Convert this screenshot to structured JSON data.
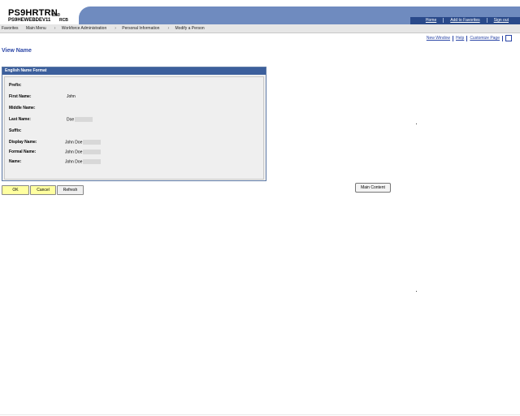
{
  "header": {
    "system_title": "PS9HRTRN",
    "version": "8.50",
    "database": "PS9HEWEBDEV11",
    "code": "RCB",
    "links": [
      "Home",
      "Add to Favorites",
      "Sign out"
    ]
  },
  "nav": {
    "items": [
      "Favorites",
      "Main Menu",
      "Workforce Administration",
      "Personal Information",
      "Modify a Person"
    ]
  },
  "page_links": [
    "New Window",
    "Help",
    "Customize Page"
  ],
  "page_title": "View Name",
  "panel": {
    "title": "English Name Format",
    "fields": [
      {
        "label": "Prefix:",
        "value": ""
      },
      {
        "label": "First Name:",
        "value": "John"
      },
      {
        "label": "Middle Name:",
        "value": ""
      },
      {
        "label": "Last Name:",
        "value": "Doe"
      },
      {
        "label": "Suffix:",
        "value": ""
      },
      {
        "label": "Display Name:",
        "value": "John Doe"
      },
      {
        "label": "Formal Name:",
        "value": "John Doe"
      },
      {
        "label": "Name:",
        "value": "John Doe"
      }
    ]
  },
  "buttons": {
    "ok": "OK",
    "cancel": "Cancel",
    "refresh": "Refresh"
  },
  "main_content_label": "Main Content",
  "colors": {
    "header_band": "#6f8bbf",
    "header_dark": "#2a4a8a",
    "panel_header": "#3c5f9c",
    "link": "#2a45a6",
    "button_yellow": "#ffffa0"
  }
}
